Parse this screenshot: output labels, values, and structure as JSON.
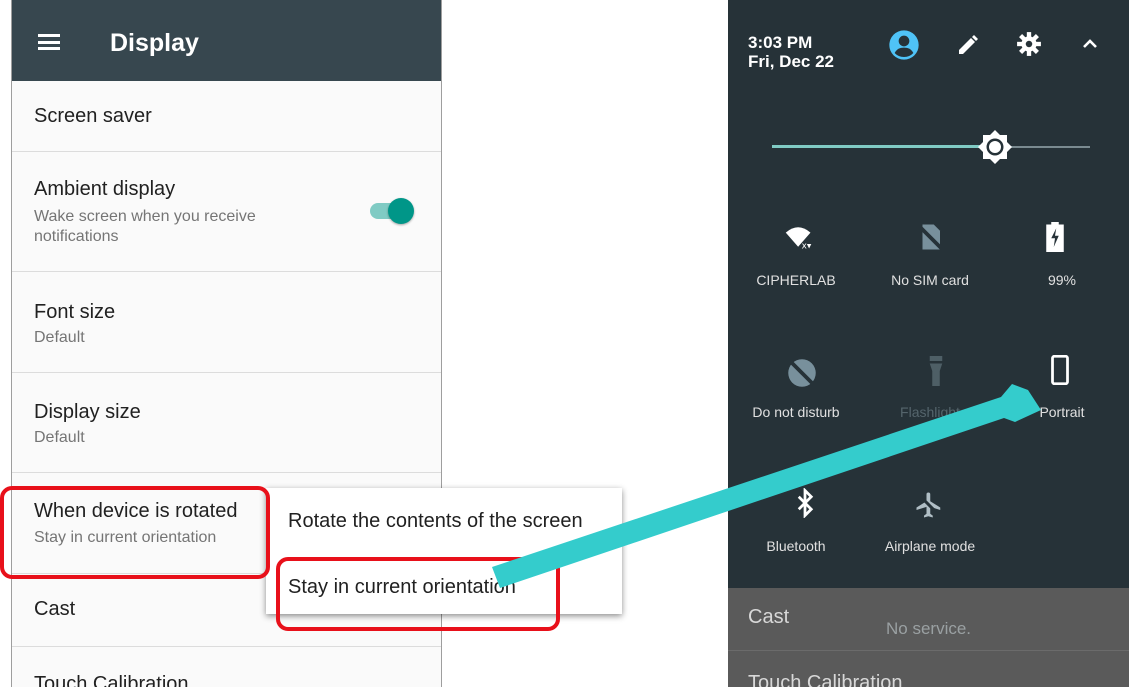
{
  "left": {
    "header": {
      "title": "Display"
    },
    "settings": [
      {
        "title": "Screen saver"
      },
      {
        "title": "Ambient display",
        "summary": "Wake screen when you receive notifications",
        "toggle_on": true
      },
      {
        "title": "Font size",
        "summary": "Default"
      },
      {
        "title": "Display size",
        "summary": "Default"
      },
      {
        "title": "When device is rotated",
        "summary": "Stay in current orientation"
      },
      {
        "title": "Cast"
      },
      {
        "title": "Touch Calibration"
      }
    ],
    "popup_menu": {
      "options": [
        "Rotate the contents of the screen",
        "Stay in current orientation"
      ],
      "selected": "Stay in current orientation"
    }
  },
  "right": {
    "status": {
      "time": "3:03 PM",
      "date": "Fri, Dec 22"
    },
    "brightness_level": 0.7,
    "tiles": [
      {
        "label": "CIPHERLAB",
        "icon": "wifi-no-internet-icon",
        "active": true
      },
      {
        "label": "No SIM card",
        "icon": "no-sim-icon",
        "active": true
      },
      {
        "label": "99%",
        "icon": "battery-charging-icon",
        "active": true
      },
      {
        "label": "Do not disturb",
        "icon": "do-not-disturb-icon",
        "active": true
      },
      {
        "label": "Flashlight",
        "icon": "flashlight-icon",
        "active": false
      },
      {
        "label": "Portrait",
        "icon": "portrait-icon",
        "active": true
      },
      {
        "label": "Bluetooth",
        "icon": "bluetooth-icon",
        "active": true
      },
      {
        "label": "Airplane mode",
        "icon": "airplane-icon",
        "active": true
      }
    ],
    "background_items": {
      "cast_label": "Cast",
      "no_service_label": "No service.",
      "touch_cal_label": "Touch Calibration"
    }
  },
  "colors": {
    "accent": "#009688",
    "highlight": "#e8101a",
    "arrow": "#34cccc",
    "appbar": "#37474f",
    "qs_background": "#263238"
  }
}
